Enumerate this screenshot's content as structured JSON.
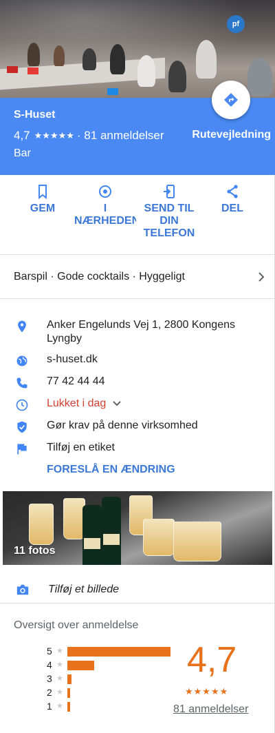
{
  "place": {
    "name": "S-Huset",
    "rating": "4,7",
    "stars": "★★★★★",
    "reviews_label": "· 81 anmeldelser",
    "category": "Bar",
    "route_label": "Rutevejledning"
  },
  "photo_sign": "pf",
  "actions": [
    {
      "label": "GEM",
      "icon": "bookmark-icon"
    },
    {
      "label": "I NÆRHEDEN",
      "icon": "nearby-pin-icon"
    },
    {
      "label": "SEND TIL DIN TELEFON",
      "icon": "send-to-phone-icon"
    },
    {
      "label": "DEL",
      "icon": "share-icon"
    }
  ],
  "tags": "Barspil · Gode cocktails · Hyggeligt",
  "info": {
    "address": "Anker Engelunds Vej 1, 2800 Kongens Lyngby",
    "website": "s-huset.dk",
    "phone": "77 42 44 44",
    "hours": "Lukket i dag",
    "claim": "Gør krav på denne virksomhed",
    "label": "Tilføj en etiket",
    "suggest": "FORESLÅ EN ÆNDRING"
  },
  "photos": {
    "count_label": "11 fotos",
    "add_label": "Tilføj et billede"
  },
  "reviews": {
    "title": "Oversigt over anmeldelse",
    "score": "4,7",
    "stars": "★★★★★",
    "link": "81 anmeldelser",
    "distribution": [
      {
        "stars": "5",
        "fraction": 0.73
      },
      {
        "stars": "4",
        "fraction": 0.19
      },
      {
        "stars": "3",
        "fraction": 0.03
      },
      {
        "stars": "2",
        "fraction": 0.02
      },
      {
        "stars": "1",
        "fraction": 0.02
      }
    ]
  },
  "colors": {
    "header_blue": "#4a89f3",
    "link_blue": "#3c78d8",
    "closed_red": "#d23f31",
    "rating_orange": "#e8711c"
  }
}
